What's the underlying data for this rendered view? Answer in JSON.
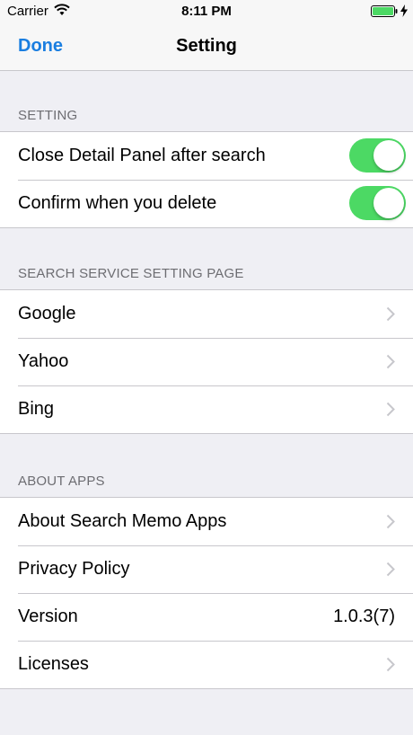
{
  "status_bar": {
    "carrier": "Carrier",
    "time": "8:11 PM"
  },
  "nav": {
    "done_label": "Done",
    "title": "Setting"
  },
  "sections": {
    "setting": {
      "header": "SETTING",
      "rows": [
        {
          "label": "Close Detail Panel after search",
          "toggle_on": true
        },
        {
          "label": "Confirm when you delete",
          "toggle_on": true
        }
      ]
    },
    "search_service": {
      "header": "SEARCH SERVICE SETTING PAGE",
      "rows": [
        {
          "label": "Google"
        },
        {
          "label": "Yahoo"
        },
        {
          "label": "Bing"
        }
      ]
    },
    "about": {
      "header": "ABOUT APPS",
      "rows": [
        {
          "label": "About Search Memo Apps"
        },
        {
          "label": "Privacy Policy"
        },
        {
          "label": "Version",
          "value": "1.0.3(7)"
        },
        {
          "label": "Licenses"
        }
      ]
    }
  },
  "colors": {
    "accent": "#1a7ee0",
    "toggle_on": "#4cd964",
    "background": "#efeff4"
  }
}
